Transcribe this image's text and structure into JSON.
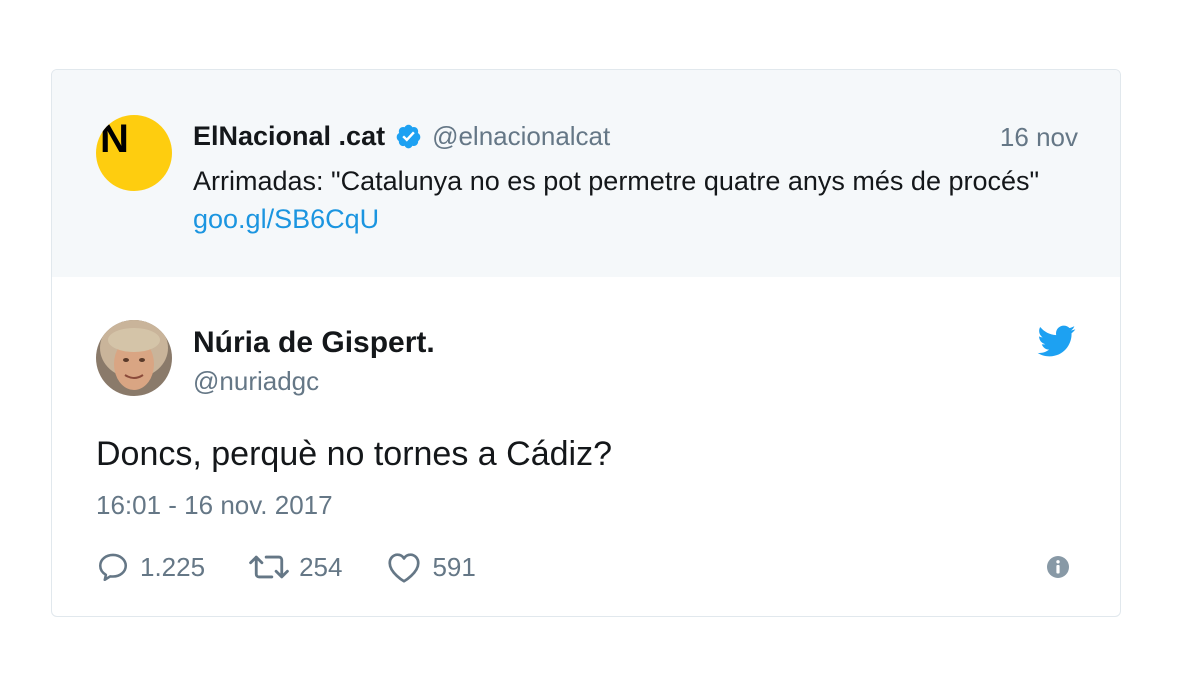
{
  "quoted_tweet": {
    "avatar_letter": "N",
    "name": "ElNacional .cat",
    "handle": "@elnacionalcat",
    "date": "16 nov",
    "text": "Arrimadas: \"Catalunya no es pot permetre quatre anys més de procés\"",
    "link": "goo.gl/SB6CqU",
    "avatar_color": "#fecd0f"
  },
  "tweet": {
    "name": "Núria de Gispert.",
    "handle": "@nuriadgc",
    "text": "Doncs, perquè no tornes a Cádiz?",
    "timestamp": "16:01 - 16 nov. 2017",
    "replies": "1.225",
    "retweets": "254",
    "likes": "591"
  },
  "icons": {
    "verified": "verified-badge-icon",
    "brand": "twitter-bird-icon",
    "reply": "reply-icon",
    "retweet": "retweet-icon",
    "like": "heart-icon",
    "info": "info-icon"
  },
  "colors": {
    "twitter_blue": "#1da1f2",
    "link_blue": "#1b95e0",
    "muted_text": "#657786",
    "context_background": "#f5f8fa"
  }
}
